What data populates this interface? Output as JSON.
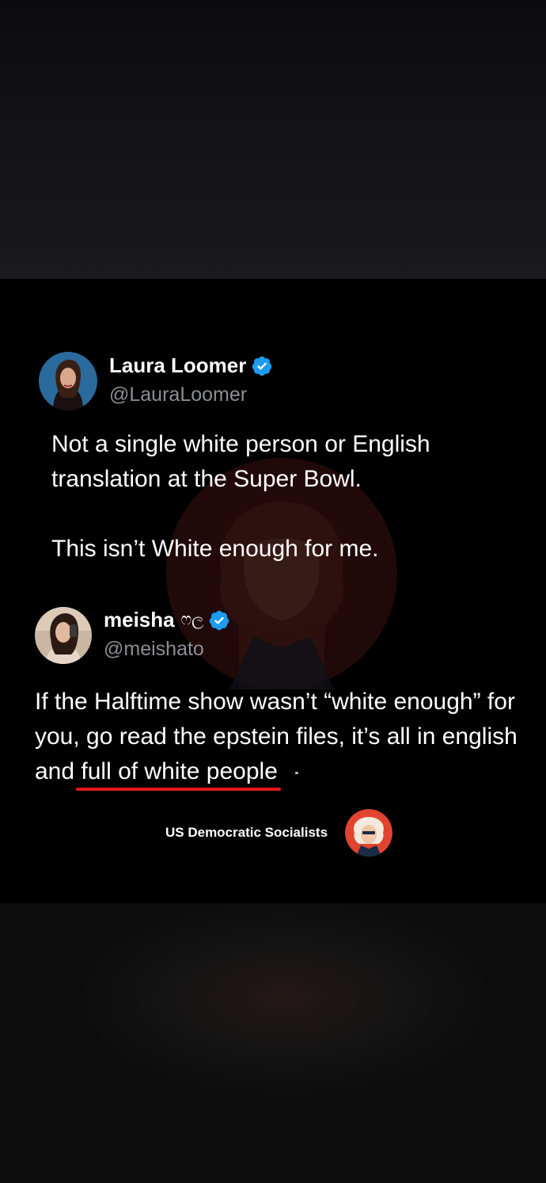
{
  "tweets": [
    {
      "name": "Laura Loomer",
      "handle": "@LauraLoomer",
      "verified": true,
      "paragraphs": [
        "Not a single white person or English translation at the Super Bowl.",
        "This isn’t White enough for me."
      ]
    },
    {
      "name": "meisha",
      "name_emoji": "ෆල",
      "handle": "@meishato",
      "verified": true,
      "text_before": "If the Halftime show wasn’t “white enough” for you, go read the epstein files, it’s all in english and ",
      "text_underlined": "full of white people"
    }
  ],
  "footer": {
    "brand": "US Democratic Socialists"
  },
  "colors": {
    "background": "#000000",
    "handle": "#8b8f94",
    "verified": "#1d9bf0",
    "underline": "#e01919"
  },
  "icons": {
    "verified": "verified-badge-icon",
    "logo": "us-democratic-socialists-logo"
  }
}
